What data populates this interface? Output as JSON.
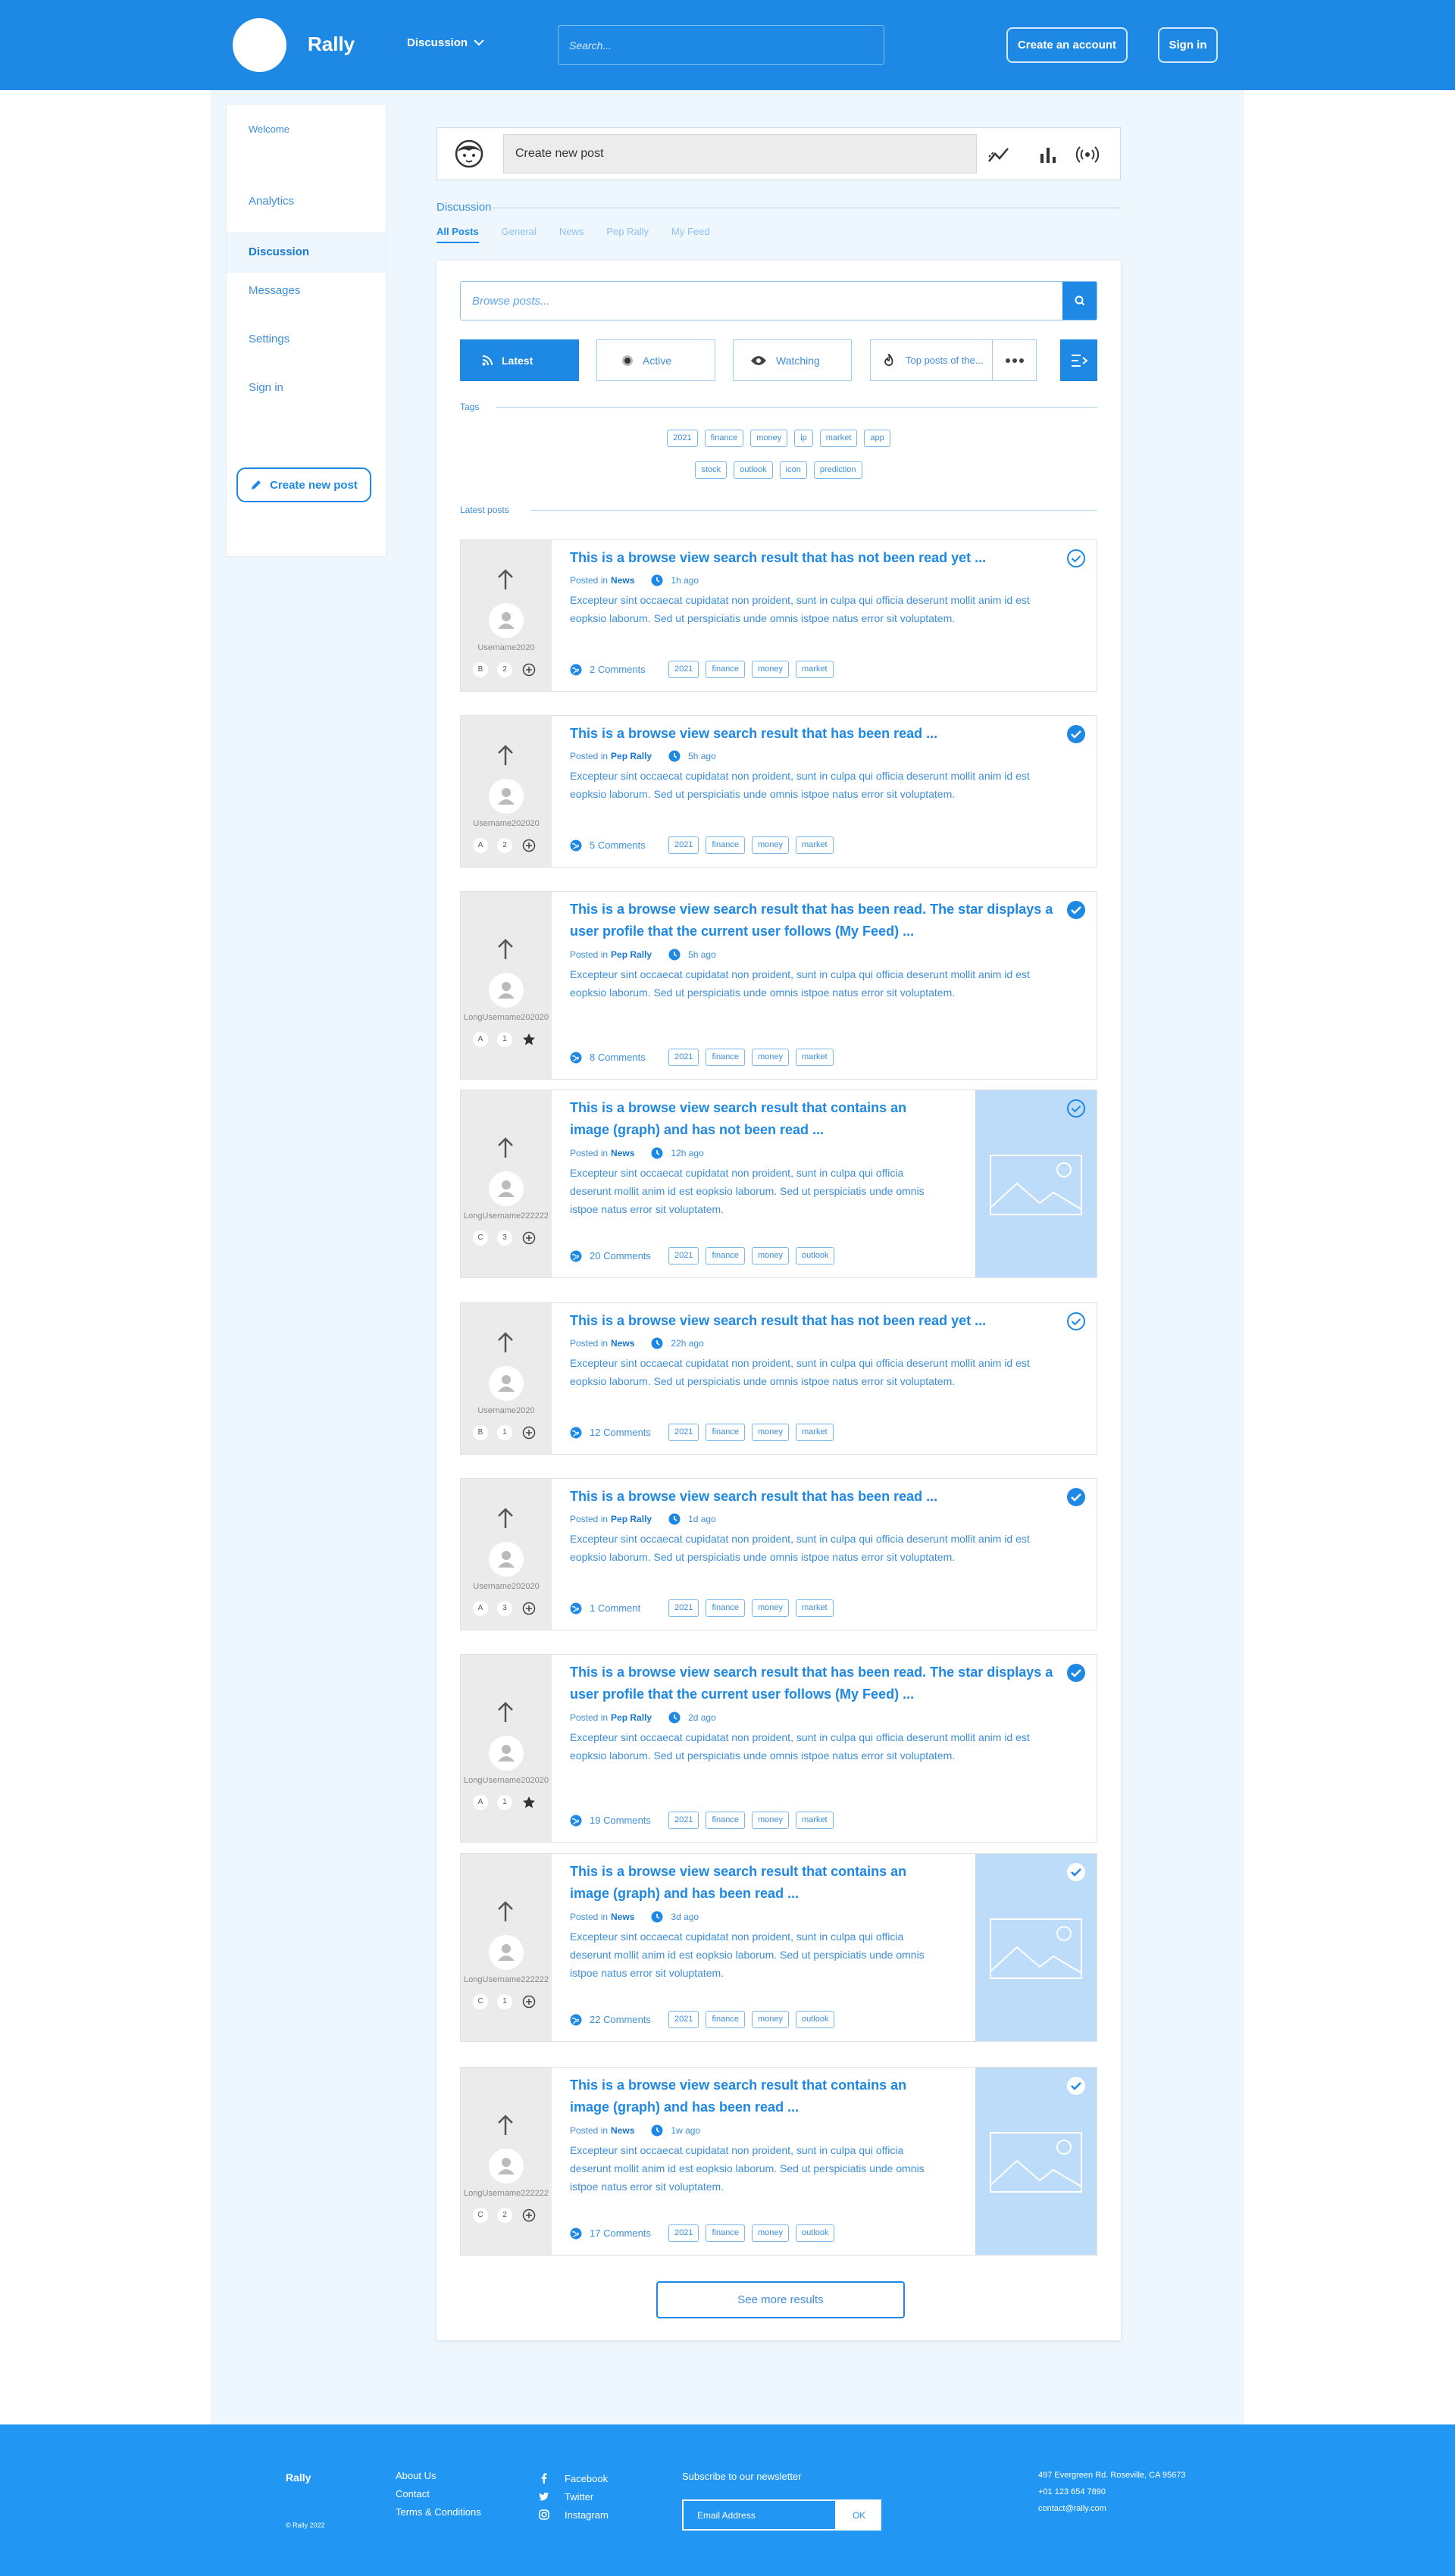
{
  "header": {
    "brand": "Rally",
    "nav_label": "Discussion",
    "search_placeholder": "Search...",
    "create_account": "Create an account",
    "sign_in": "Sign in"
  },
  "sidebar": {
    "items": [
      {
        "label": "Welcome"
      },
      {
        "label": "Analytics"
      },
      {
        "label": "Discussion"
      },
      {
        "label": "Messages"
      },
      {
        "label": "Settings"
      },
      {
        "label": "Sign in"
      }
    ],
    "create_post": "Create new post"
  },
  "composer": {
    "placeholder": "Create new post"
  },
  "discussion": {
    "label": "Discussion",
    "tabs": [
      "All Posts",
      "General",
      "News",
      "Pep Rally",
      "My Feed"
    ]
  },
  "browse": {
    "placeholder": "Browse posts..."
  },
  "filters": [
    "Latest",
    "Active",
    "Watching",
    "Top posts of the..."
  ],
  "tags_label": "Tags",
  "tags_row1": [
    "2021",
    "finance",
    "money",
    "ip",
    "market",
    "app"
  ],
  "tags_row2": [
    "stock",
    "outlook",
    "icon",
    "prediction"
  ],
  "latest_label": "Latest posts",
  "posted_in": "Posted in",
  "body_text": "Excepteur sint occaecat cupidatat non proident, sunt in culpa qui officia deserunt mollit anim id est eopksio laborum. Sed ut perspiciatis unde omnis istpoe natus error sit voluptatem.",
  "posts": [
    {
      "title": "This is a browse view search result that has not been read yet ...",
      "category": "News",
      "time": "1h ago",
      "user": "Username2020",
      "b1": "B",
      "b2": "2",
      "comments": "2 Comments",
      "tags": [
        "2021",
        "finance",
        "money",
        "market"
      ]
    },
    {
      "title": "This is a browse view search result that has been read ...",
      "category": "Pep Rally",
      "time": "5h ago",
      "user": "Username202020",
      "b1": "A",
      "b2": "2",
      "comments": "5 Comments",
      "tags": [
        "2021",
        "finance",
        "money",
        "market"
      ]
    },
    {
      "title": "This is a browse view search result that has been read. The star displays a user profile that the current user follows (My Feed) ...",
      "category": "Pep Rally",
      "time": "5h ago",
      "user": "LongUsername202020",
      "b1": "A",
      "b2": "1",
      "comments": "8 Comments",
      "tags": [
        "2021",
        "finance",
        "money",
        "market"
      ]
    },
    {
      "title": "This is a browse view search result that contains an image (graph) and has not been read ...",
      "category": "News",
      "time": "12h ago",
      "user": "LongUsername222222",
      "b1": "C",
      "b2": "3",
      "comments": "20 Comments",
      "tags": [
        "2021",
        "finance",
        "money",
        "outlook"
      ]
    },
    {
      "title": "This is a browse view search result that has not been read yet ...",
      "category": "News",
      "time": "22h ago",
      "user": "Username2020",
      "b1": "B",
      "b2": "1",
      "comments": "12 Comments",
      "tags": [
        "2021",
        "finance",
        "money",
        "market"
      ]
    },
    {
      "title": "This is a browse view search result that has been read ...",
      "category": "Pep Rally",
      "time": "1d ago",
      "user": "Username202020",
      "b1": "A",
      "b2": "3",
      "comments": "1 Comment",
      "tags": [
        "2021",
        "finance",
        "money",
        "market"
      ]
    },
    {
      "title": "This is a browse view search result that has been read. The star displays a user profile that the current user follows (My Feed) ...",
      "category": "Pep Rally",
      "time": "2d ago",
      "user": "LongUsername202020",
      "b1": "A",
      "b2": "1",
      "comments": "19 Comments",
      "tags": [
        "2021",
        "finance",
        "money",
        "market"
      ]
    },
    {
      "title": "This is a browse view search result that contains an image (graph) and has been read ...",
      "category": "News",
      "time": "3d ago",
      "user": "LongUsername222222",
      "b1": "C",
      "b2": "1",
      "comments": "22 Comments",
      "tags": [
        "2021",
        "finance",
        "money",
        "outlook"
      ]
    },
    {
      "title": "This is a browse view search result that contains an image (graph) and has been read ...",
      "category": "News",
      "time": "1w ago",
      "user": "LongUsername222222",
      "b1": "C",
      "b2": "2",
      "comments": "17 Comments",
      "tags": [
        "2021",
        "finance",
        "money",
        "outlook"
      ]
    }
  ],
  "see_more": "See more results",
  "footer": {
    "brand": "Rally",
    "copyright": "© Rally 2022",
    "links": [
      "About Us",
      "Contact",
      "Terms & Conditions"
    ],
    "social": [
      "Facebook",
      "Twitter",
      "Instagram"
    ],
    "newsletter_title": "Subscribe to our newsletter",
    "email_placeholder": "Email Address",
    "ok": "OK",
    "address": "497 Evergreen Rd. Roseville, CA 95673",
    "phone": "+01 123 654 7890",
    "email": "contact@rally.com"
  },
  "colors": {
    "primary": "#1e88e5",
    "footer": "#2196f3",
    "page_bg": "#eef6fe"
  }
}
